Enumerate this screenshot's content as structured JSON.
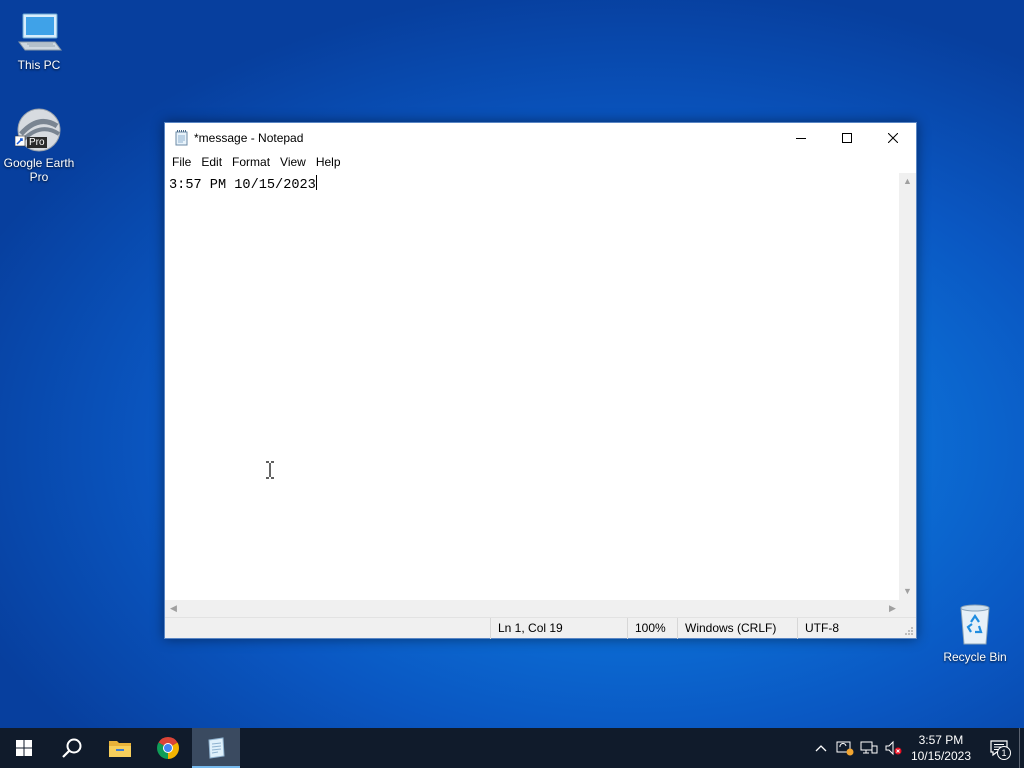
{
  "desktop": {
    "icons": [
      {
        "label": "This PC"
      },
      {
        "label": "Google Earth Pro",
        "badge": "Pro"
      },
      {
        "label": "Recycle Bin"
      }
    ]
  },
  "notepad": {
    "title": "*message - Notepad",
    "menu": [
      "File",
      "Edit",
      "Format",
      "View",
      "Help"
    ],
    "content": "3:57 PM 10/15/2023",
    "status": {
      "position": "Ln 1, Col 19",
      "zoom": "100%",
      "line_endings": "Windows (CRLF)",
      "encoding": "UTF-8"
    }
  },
  "taskbar": {
    "apps": [
      "start",
      "search",
      "file-explorer",
      "chrome",
      "notepad"
    ],
    "active_app": "notepad",
    "clock": {
      "time": "3:57 PM",
      "date": "10/15/2023"
    },
    "notification_count": "1"
  },
  "colors": {
    "taskbar_bg": "#101b2b",
    "desktop_blue": "#0a6ad4",
    "active_indicator": "#76b9ed"
  }
}
